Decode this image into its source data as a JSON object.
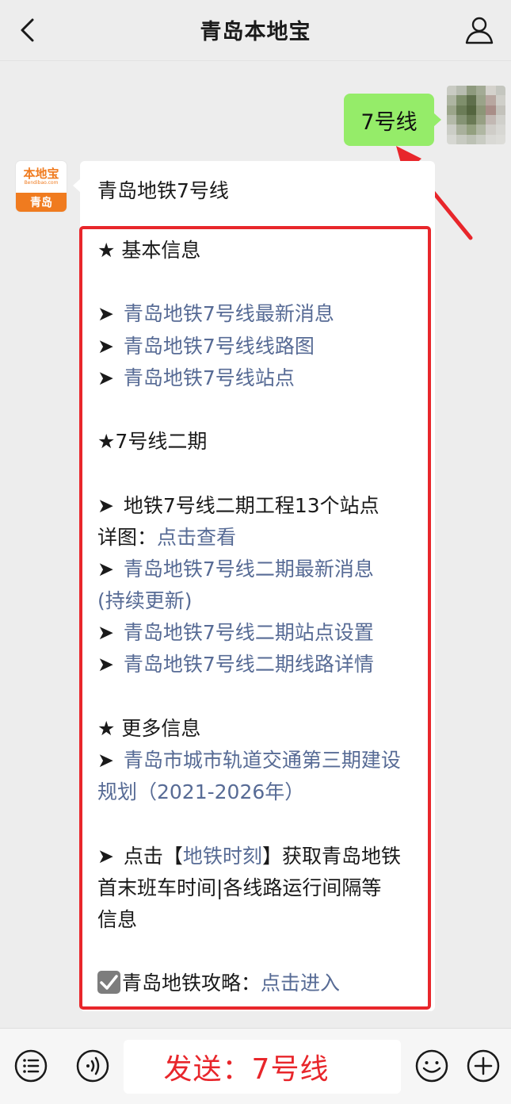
{
  "header": {
    "title": "青岛本地宝"
  },
  "outgoing": {
    "text": "7号线"
  },
  "incoming": {
    "avatar": {
      "main": "本地宝",
      "url": "Bendibao.com",
      "city": "青岛"
    },
    "title": "青岛地铁7号线",
    "lines": [
      {
        "type": "text",
        "parts": [
          {
            "t": "★ 基本信息"
          }
        ]
      },
      {
        "type": "blank"
      },
      {
        "type": "item",
        "parts": [
          {
            "t": "➤ ",
            "c": "bullet"
          },
          {
            "t": "青岛地铁7号线最新消息",
            "c": "link"
          }
        ]
      },
      {
        "type": "item",
        "parts": [
          {
            "t": "➤ ",
            "c": "bullet"
          },
          {
            "t": "青岛地铁7号线线路图",
            "c": "link"
          }
        ]
      },
      {
        "type": "item",
        "parts": [
          {
            "t": "➤ ",
            "c": "bullet"
          },
          {
            "t": "青岛地铁7号线站点",
            "c": "link"
          }
        ]
      },
      {
        "type": "blank"
      },
      {
        "type": "text",
        "parts": [
          {
            "t": "★7号线二期"
          }
        ]
      },
      {
        "type": "blank"
      },
      {
        "type": "item",
        "parts": [
          {
            "t": "➤ ",
            "c": "bullet"
          },
          {
            "t": "地铁7号线二期工程13个站点"
          }
        ]
      },
      {
        "type": "item",
        "parts": [
          {
            "t": "详图："
          },
          {
            "t": "点击查看",
            "c": "link"
          }
        ]
      },
      {
        "type": "item",
        "parts": [
          {
            "t": "➤ ",
            "c": "bullet"
          },
          {
            "t": "青岛地铁7号线二期最新消息",
            "c": "link"
          }
        ]
      },
      {
        "type": "item",
        "parts": [
          {
            "t": "(持续更新)",
            "c": "link"
          }
        ]
      },
      {
        "type": "item",
        "parts": [
          {
            "t": "➤ ",
            "c": "bullet"
          },
          {
            "t": "青岛地铁7号线二期站点设置",
            "c": "link"
          }
        ]
      },
      {
        "type": "item",
        "parts": [
          {
            "t": "➤ ",
            "c": "bullet"
          },
          {
            "t": "青岛地铁7号线二期线路详情",
            "c": "link"
          }
        ]
      },
      {
        "type": "blank"
      },
      {
        "type": "text",
        "parts": [
          {
            "t": "★ 更多信息"
          }
        ]
      },
      {
        "type": "item",
        "parts": [
          {
            "t": "➤ ",
            "c": "bullet"
          },
          {
            "t": "青岛市城市轨道交通第三期建设",
            "c": "link"
          }
        ]
      },
      {
        "type": "item",
        "parts": [
          {
            "t": "规划（2021-2026年）",
            "c": "link"
          }
        ]
      },
      {
        "type": "blank"
      },
      {
        "type": "item",
        "parts": [
          {
            "t": "➤ ",
            "c": "bullet"
          },
          {
            "t": "点击【"
          },
          {
            "t": "地铁时刻",
            "c": "link"
          },
          {
            "t": "】获取青岛地铁"
          }
        ]
      },
      {
        "type": "text",
        "parts": [
          {
            "t": "首末班车时间|各线路运行间隔等"
          }
        ]
      },
      {
        "type": "text",
        "parts": [
          {
            "t": "信息"
          }
        ]
      },
      {
        "type": "blank"
      },
      {
        "type": "check",
        "parts": [
          {
            "t": "青岛地铁攻略："
          },
          {
            "t": "点击进入",
            "c": "link"
          }
        ]
      }
    ]
  },
  "toolbar": {
    "input_text": "发送：7号线",
    "icons": [
      "menu-list-icon",
      "voice-icon",
      "emoji-icon",
      "plus-icon"
    ]
  },
  "colors": {
    "background": "#ededed",
    "outgoing_bubble": "#95ec69",
    "link": "#576b95",
    "annotation_red": "#e8262b",
    "brand_orange": "#f07b1f"
  }
}
